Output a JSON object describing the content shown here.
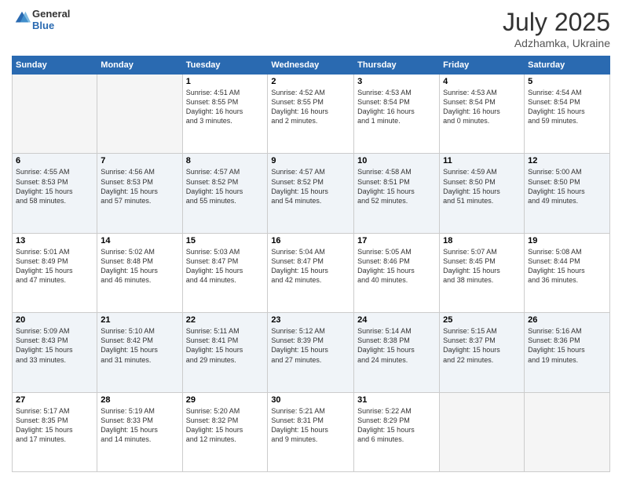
{
  "header": {
    "logo_line1": "General",
    "logo_line2": "Blue",
    "month": "July 2025",
    "location": "Adzhamka, Ukraine"
  },
  "days_of_week": [
    "Sunday",
    "Monday",
    "Tuesday",
    "Wednesday",
    "Thursday",
    "Friday",
    "Saturday"
  ],
  "weeks": [
    [
      {
        "day": "",
        "info": ""
      },
      {
        "day": "",
        "info": ""
      },
      {
        "day": "1",
        "info": "Sunrise: 4:51 AM\nSunset: 8:55 PM\nDaylight: 16 hours\nand 3 minutes."
      },
      {
        "day": "2",
        "info": "Sunrise: 4:52 AM\nSunset: 8:55 PM\nDaylight: 16 hours\nand 2 minutes."
      },
      {
        "day": "3",
        "info": "Sunrise: 4:53 AM\nSunset: 8:54 PM\nDaylight: 16 hours\nand 1 minute."
      },
      {
        "day": "4",
        "info": "Sunrise: 4:53 AM\nSunset: 8:54 PM\nDaylight: 16 hours\nand 0 minutes."
      },
      {
        "day": "5",
        "info": "Sunrise: 4:54 AM\nSunset: 8:54 PM\nDaylight: 15 hours\nand 59 minutes."
      }
    ],
    [
      {
        "day": "6",
        "info": "Sunrise: 4:55 AM\nSunset: 8:53 PM\nDaylight: 15 hours\nand 58 minutes."
      },
      {
        "day": "7",
        "info": "Sunrise: 4:56 AM\nSunset: 8:53 PM\nDaylight: 15 hours\nand 57 minutes."
      },
      {
        "day": "8",
        "info": "Sunrise: 4:57 AM\nSunset: 8:52 PM\nDaylight: 15 hours\nand 55 minutes."
      },
      {
        "day": "9",
        "info": "Sunrise: 4:57 AM\nSunset: 8:52 PM\nDaylight: 15 hours\nand 54 minutes."
      },
      {
        "day": "10",
        "info": "Sunrise: 4:58 AM\nSunset: 8:51 PM\nDaylight: 15 hours\nand 52 minutes."
      },
      {
        "day": "11",
        "info": "Sunrise: 4:59 AM\nSunset: 8:50 PM\nDaylight: 15 hours\nand 51 minutes."
      },
      {
        "day": "12",
        "info": "Sunrise: 5:00 AM\nSunset: 8:50 PM\nDaylight: 15 hours\nand 49 minutes."
      }
    ],
    [
      {
        "day": "13",
        "info": "Sunrise: 5:01 AM\nSunset: 8:49 PM\nDaylight: 15 hours\nand 47 minutes."
      },
      {
        "day": "14",
        "info": "Sunrise: 5:02 AM\nSunset: 8:48 PM\nDaylight: 15 hours\nand 46 minutes."
      },
      {
        "day": "15",
        "info": "Sunrise: 5:03 AM\nSunset: 8:47 PM\nDaylight: 15 hours\nand 44 minutes."
      },
      {
        "day": "16",
        "info": "Sunrise: 5:04 AM\nSunset: 8:47 PM\nDaylight: 15 hours\nand 42 minutes."
      },
      {
        "day": "17",
        "info": "Sunrise: 5:05 AM\nSunset: 8:46 PM\nDaylight: 15 hours\nand 40 minutes."
      },
      {
        "day": "18",
        "info": "Sunrise: 5:07 AM\nSunset: 8:45 PM\nDaylight: 15 hours\nand 38 minutes."
      },
      {
        "day": "19",
        "info": "Sunrise: 5:08 AM\nSunset: 8:44 PM\nDaylight: 15 hours\nand 36 minutes."
      }
    ],
    [
      {
        "day": "20",
        "info": "Sunrise: 5:09 AM\nSunset: 8:43 PM\nDaylight: 15 hours\nand 33 minutes."
      },
      {
        "day": "21",
        "info": "Sunrise: 5:10 AM\nSunset: 8:42 PM\nDaylight: 15 hours\nand 31 minutes."
      },
      {
        "day": "22",
        "info": "Sunrise: 5:11 AM\nSunset: 8:41 PM\nDaylight: 15 hours\nand 29 minutes."
      },
      {
        "day": "23",
        "info": "Sunrise: 5:12 AM\nSunset: 8:39 PM\nDaylight: 15 hours\nand 27 minutes."
      },
      {
        "day": "24",
        "info": "Sunrise: 5:14 AM\nSunset: 8:38 PM\nDaylight: 15 hours\nand 24 minutes."
      },
      {
        "day": "25",
        "info": "Sunrise: 5:15 AM\nSunset: 8:37 PM\nDaylight: 15 hours\nand 22 minutes."
      },
      {
        "day": "26",
        "info": "Sunrise: 5:16 AM\nSunset: 8:36 PM\nDaylight: 15 hours\nand 19 minutes."
      }
    ],
    [
      {
        "day": "27",
        "info": "Sunrise: 5:17 AM\nSunset: 8:35 PM\nDaylight: 15 hours\nand 17 minutes."
      },
      {
        "day": "28",
        "info": "Sunrise: 5:19 AM\nSunset: 8:33 PM\nDaylight: 15 hours\nand 14 minutes."
      },
      {
        "day": "29",
        "info": "Sunrise: 5:20 AM\nSunset: 8:32 PM\nDaylight: 15 hours\nand 12 minutes."
      },
      {
        "day": "30",
        "info": "Sunrise: 5:21 AM\nSunset: 8:31 PM\nDaylight: 15 hours\nand 9 minutes."
      },
      {
        "day": "31",
        "info": "Sunrise: 5:22 AM\nSunset: 8:29 PM\nDaylight: 15 hours\nand 6 minutes."
      },
      {
        "day": "",
        "info": ""
      },
      {
        "day": "",
        "info": ""
      }
    ]
  ]
}
